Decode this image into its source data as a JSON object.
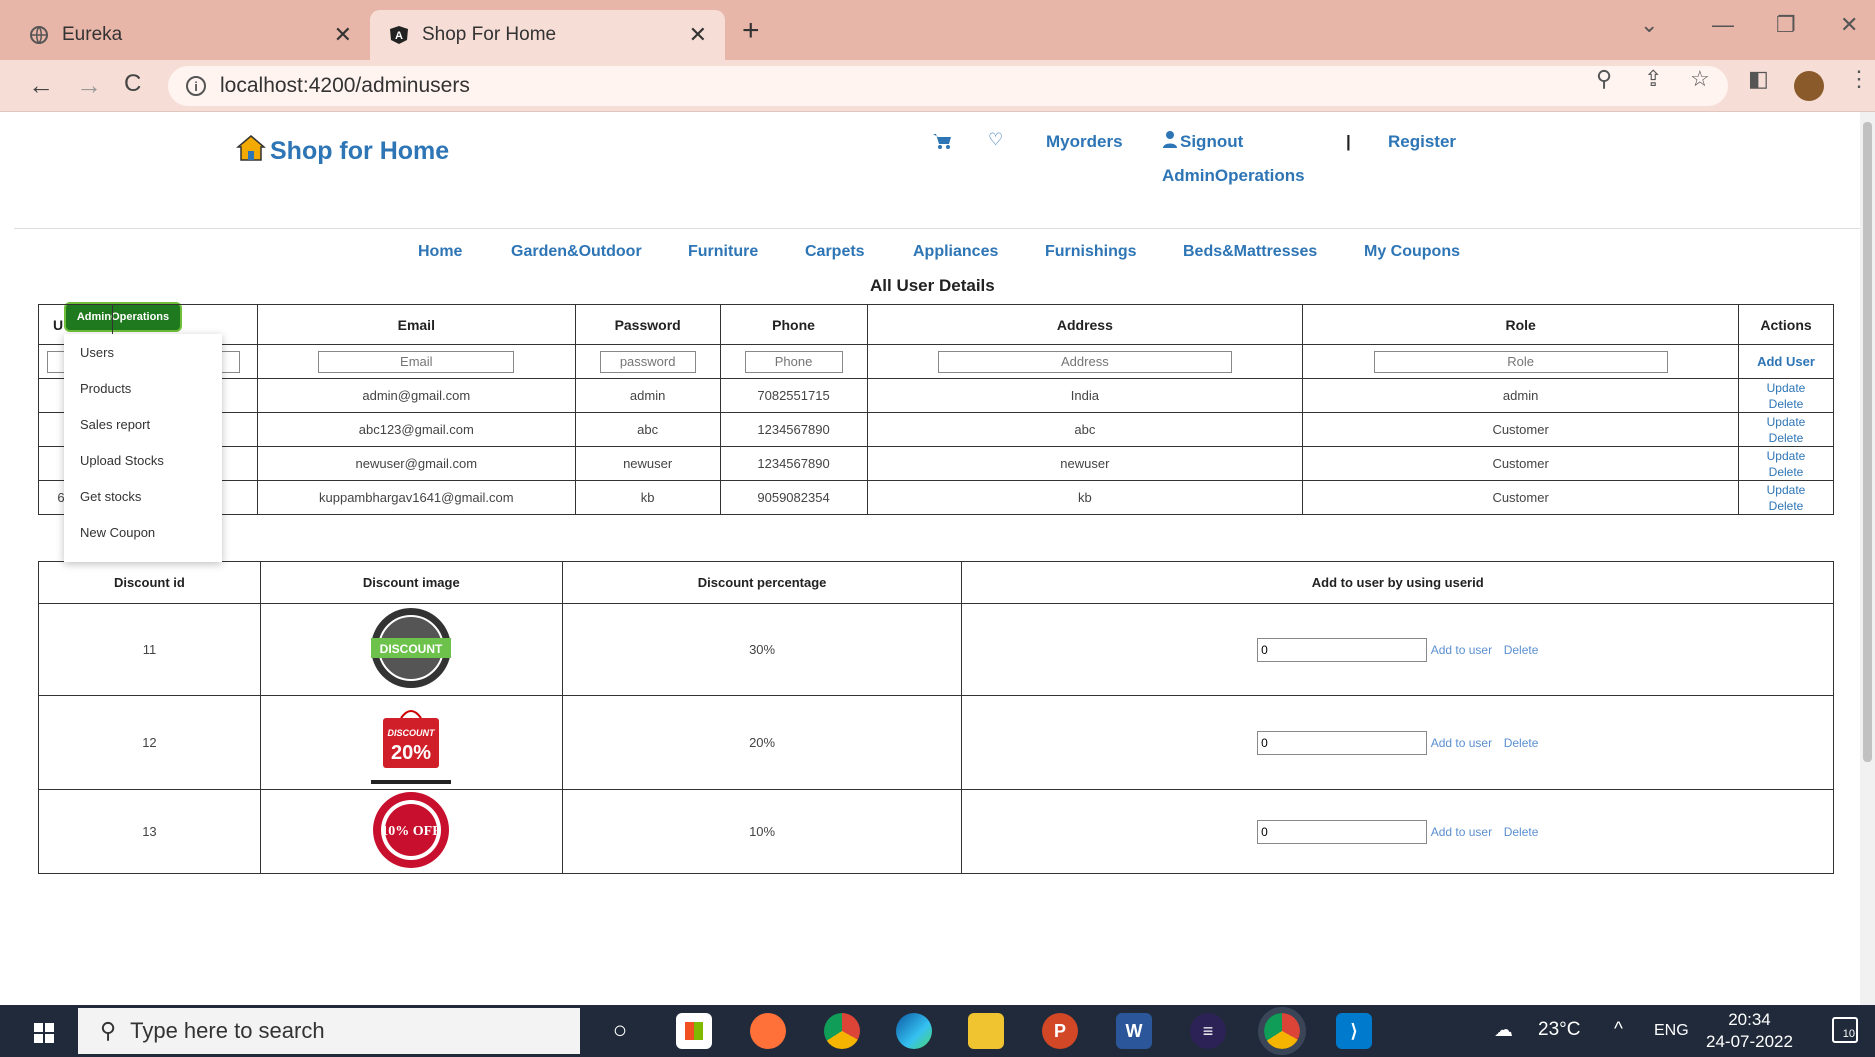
{
  "browser": {
    "tabs": [
      {
        "title": "Eureka",
        "active": false
      },
      {
        "title": "Shop For Home",
        "active": true
      }
    ],
    "url": "localhost:4200/adminusers"
  },
  "header": {
    "brand": "Shop for Home",
    "links": {
      "myorders": "Myorders",
      "signout": "Signout",
      "separator": "|",
      "register": "Register",
      "adminops": "AdminOperations"
    }
  },
  "categories": [
    "Home",
    "Garden&Outdoor",
    "Furniture",
    "Carpets",
    "Appliances",
    "Furnishings",
    "Beds&Mattresses",
    "My Coupons"
  ],
  "admin_menu": {
    "button": "AdminOperations",
    "items": [
      "Users",
      "Products",
      "Sales report",
      "Upload Stocks",
      "Get stocks",
      "New Coupon"
    ]
  },
  "users_section": {
    "title": "All User Details",
    "headers": [
      "U",
      "",
      "Email",
      "Password",
      "Phone",
      "Address",
      "Role",
      "Actions"
    ],
    "placeholders": {
      "email": "Email",
      "password": "password",
      "phone": "Phone",
      "address": "Address",
      "role": "Role"
    },
    "add_user": "Add User",
    "update": "Update",
    "delete": "Delete",
    "rows": [
      {
        "id": "",
        "name": "",
        "email": "admin@gmail.com",
        "password": "admin",
        "phone": "7082551715",
        "address": "India",
        "role": "admin"
      },
      {
        "id": "",
        "name": "",
        "email": "abc123@gmail.com",
        "password": "abc",
        "phone": "1234567890",
        "address": "abc",
        "role": "Customer"
      },
      {
        "id": "",
        "name": "",
        "email": "newuser@gmail.com",
        "password": "newuser",
        "phone": "1234567890",
        "address": "newuser",
        "role": "Customer"
      },
      {
        "id": "63167",
        "name": "kb",
        "email": "kuppambhargav1641@gmail.com",
        "password": "kb",
        "phone": "9059082354",
        "address": "kb",
        "role": "Customer"
      }
    ]
  },
  "coupons_section": {
    "headers": [
      "Discount id",
      "Discount image",
      "Discount percentage",
      "Add to user by using userid"
    ],
    "add_to_user": "Add to user",
    "delete": "Delete",
    "rows": [
      {
        "id": "11",
        "percent": "30%",
        "input": "0",
        "image_text": "DISCOUNT"
      },
      {
        "id": "12",
        "percent": "20%",
        "input": "0",
        "image_text": "20%"
      },
      {
        "id": "13",
        "percent": "10%",
        "input": "0",
        "image_text": "10% OFF"
      }
    ]
  },
  "taskbar": {
    "search_placeholder": "Type here to search",
    "weather": "23°C",
    "lang": "ENG",
    "time": "20:34",
    "date": "24-07-2022",
    "notifications": "10"
  },
  "colors": {
    "link": "#2e75b6",
    "tabstrip": "#e8b6a8",
    "admin_button": "#1f7a1f"
  }
}
